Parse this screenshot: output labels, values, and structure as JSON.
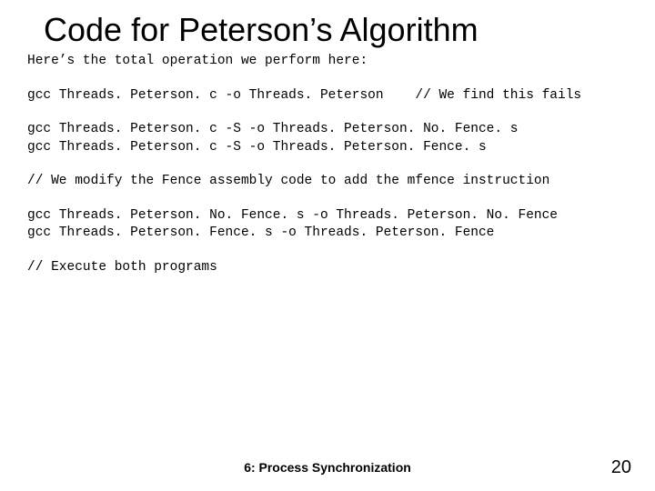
{
  "title": "Code for Peterson’s Algorithm",
  "lines": {
    "l0": "Here’s the total operation we perform here:",
    "l1": "gcc Threads. Peterson. c -o Threads. Peterson    // We find this fails",
    "l2": "gcc Threads. Peterson. c -S -o Threads. Peterson. No. Fence. s",
    "l3": "gcc Threads. Peterson. c -S -o Threads. Peterson. Fence. s",
    "l4": "// We modify the Fence assembly code to add the mfence instruction",
    "l5": "gcc Threads. Peterson. No. Fence. s -o Threads. Peterson. No. Fence",
    "l6": "gcc Threads. Peterson. Fence. s -o Threads. Peterson. Fence",
    "l7": "// Execute both programs"
  },
  "footer": "6: Process Synchronization",
  "page": "20"
}
